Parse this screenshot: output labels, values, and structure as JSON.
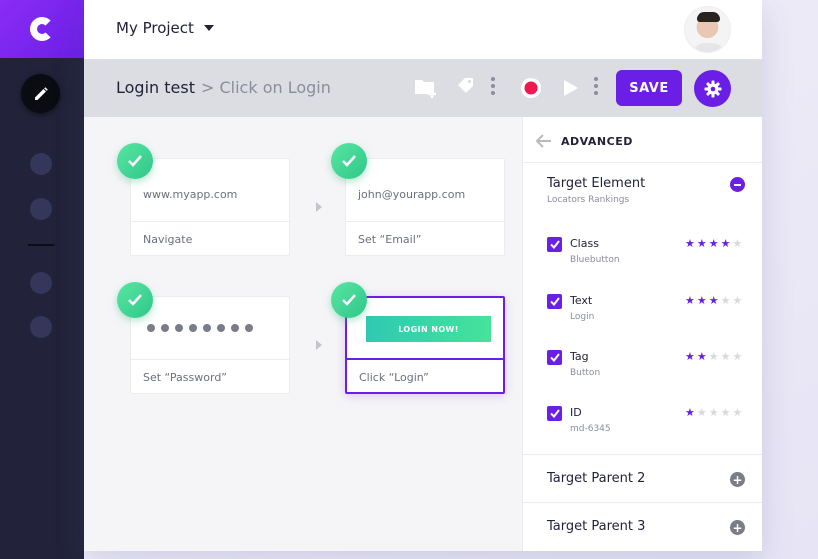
{
  "header": {
    "project_name": "My Project",
    "logo_letter": "C"
  },
  "toolbar": {
    "title": "Login test",
    "subtitle": "> Click on Login",
    "save_label": "SAVE"
  },
  "steps": [
    {
      "value": "www.myapp.com",
      "label": "Navigate"
    },
    {
      "value": "john@yourapp.com",
      "label": "Set “Email”"
    },
    {
      "value": "",
      "label": "Set “Password”",
      "masked": true
    },
    {
      "value": "",
      "label": "Click “Login”",
      "button_text": "LOGIN NOW!"
    }
  ],
  "panel": {
    "title": "ADVANCED",
    "section_title": "Target Element",
    "section_sub": "Locators Rankings",
    "locators": [
      {
        "name": "Class",
        "value": "Bluebutton",
        "rating": 4
      },
      {
        "name": "Text",
        "value": "Login",
        "rating": 3
      },
      {
        "name": "Tag",
        "value": "Button",
        "rating": 2
      },
      {
        "name": "ID",
        "value": "md-6345",
        "rating": 1
      }
    ],
    "collapsed": [
      {
        "label": "Target Parent 2"
      },
      {
        "label": "Target Parent 3"
      }
    ]
  },
  "colors": {
    "accent": "#6b1fe6",
    "sidebar": "#22233a",
    "success": "#3fd493",
    "star_off": "#d8d9de"
  },
  "icons": [
    "pencil-icon",
    "folder-add-icon",
    "tag-icon",
    "more-vertical-icon",
    "record-icon",
    "play-icon",
    "gear-icon",
    "arrow-left-icon",
    "check-icon",
    "minus-icon",
    "plus-icon",
    "star-icon"
  ]
}
